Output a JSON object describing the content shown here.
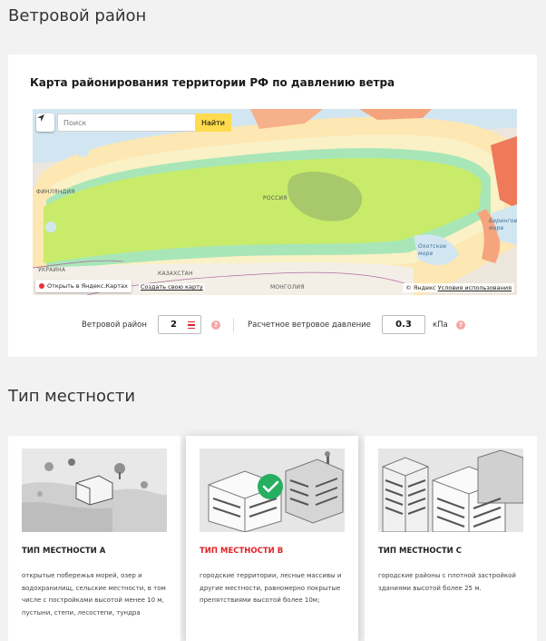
{
  "wind": {
    "section_title": "Ветровой район",
    "map": {
      "title": "Карта районирования территории РФ по давлению ветра",
      "search_placeholder": "Поиск",
      "search_button": "Найти",
      "labels": {
        "finland": "ФИНЛЯНДИЯ",
        "russia": "РОССИЯ",
        "ukraine": "УКРАИНА",
        "kazakhstan": "КАЗАХСТАН",
        "mongolia": "МОНГОЛИЯ",
        "bering_sea": "Берингово\nморе",
        "okhotsk_sea": "Охотское\nморе"
      },
      "open_yandex": "Открыть в Яндекс.Картах",
      "create_map": "Создать свою карту",
      "copyright": "© Яндекс",
      "terms": "Условия использования"
    },
    "region_label": "Ветровой район",
    "region_value": "2",
    "pressure_label": "Расчетное ветровое давление",
    "pressure_value": "0.3",
    "pressure_unit": "кПа",
    "help_glyph": "?"
  },
  "terrain": {
    "section_title": "Тип местности",
    "cards": [
      {
        "name": "ТИП МЕСТНОСТИ А",
        "desc": "открытые побережья морей, озер и водохранилищ, сельские местности, в том числе с постройками высотой менее 10 м, пустыни, степи, лесостепи, тундра",
        "selected": false
      },
      {
        "name": "ТИП МЕСТНОСТИ В",
        "desc": "городские территории, лесные массивы и другие местности, равномерно покрытые препятствиями высотой более 10м;",
        "selected": true
      },
      {
        "name": "ТИП МЕСТНОСТИ С",
        "desc": "городские районы с плотной застройкой зданиями высотой более 25 м.",
        "selected": false
      }
    ]
  },
  "colors": {
    "accent": "#e31e24",
    "search_button": "#ffdb4d",
    "zone_green": "#c8ec6a",
    "zone_yellow": "#fbe9b0"
  }
}
